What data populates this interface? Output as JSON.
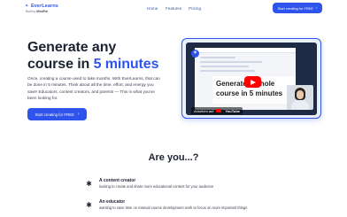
{
  "brand": {
    "name": "EverLearns",
    "tagline_prefix": "Built by",
    "tagline_company": "MindPal",
    "logo_icon": "star-logo-icon",
    "accent_color": "#2f54eb"
  },
  "nav": {
    "items": [
      "Home",
      "Features",
      "Pricing"
    ],
    "cta_label": "Start creating for FREE",
    "cta_icon": "arrow-right-icon"
  },
  "hero": {
    "title_line1": "Generate any",
    "title_line2_prefix": "course in",
    "title_line2_accent": "5 minutes",
    "description": "Once, creating a course used to take months. With EverLearns, that can be done in 5 minutes. Think about all the time, effort, and energy you save! Educators, content creators, and parents — This is what you've been looking for.",
    "cta_label": "Start creating for FREE",
    "cta_icon": "arrow-right-icon"
  },
  "video": {
    "title": "Generate a whole course in 5 minutes",
    "watch_on": "Ansehen auf",
    "platform": "YouTube",
    "play_icon": "play-icon"
  },
  "audience": {
    "heading": "Are you...?",
    "items": [
      {
        "icon": "sparkle-icon",
        "title": "A content creator",
        "description": "looking to create and share more educational content for your audience"
      },
      {
        "icon": "sparkle-icon",
        "title": "An educator",
        "description": "wanting to save time on manual course development work to focus on more important things"
      }
    ]
  }
}
